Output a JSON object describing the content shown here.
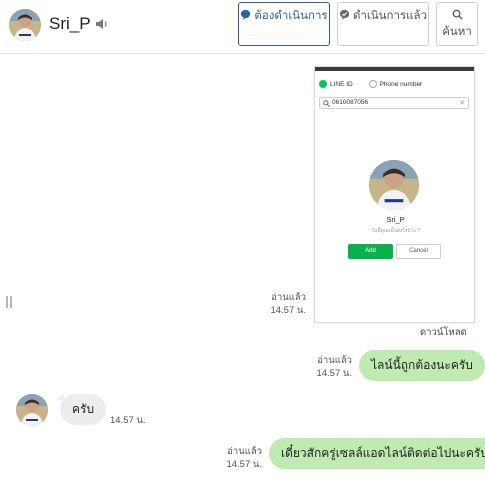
{
  "header": {
    "name": "Sri_P",
    "buttons": {
      "pending": "ต้องดำเนินการ",
      "done": "ดำเนินการแล้ว",
      "search": "ค้นหา"
    }
  },
  "colors": {
    "accent": "#2b5fb4",
    "out_bubble": "#bfeab1",
    "in_bubble": "#ededed",
    "line_green": "#06c755"
  },
  "screenshot": {
    "option_line_id": "LINE ID",
    "option_phone": "Phone number",
    "search_value": "0610087056",
    "profile_name": "Sri_P",
    "profile_sub": "วันนี้คุณเป็นยังไงบ้าง ?",
    "add_label": "Add",
    "cancel_label": "Cancel"
  },
  "messages": [
    {
      "read": "อ่านแล้ว",
      "time": "14.57 น."
    },
    {
      "note": "ดาวน์โหลด"
    },
    {
      "text": "ไลน์นี้ถูกต้องนะครับ",
      "read": "อ่านแล้ว",
      "time": "14.57 น."
    },
    {
      "text": "ครับ",
      "time": "14.57 น."
    },
    {
      "text": "เดี๋ยวสักครู่เซลล์แอดไลน์ติดต่อไปนะครับ",
      "read": "อ่านแล้ว",
      "time": "14.57 น."
    }
  ]
}
